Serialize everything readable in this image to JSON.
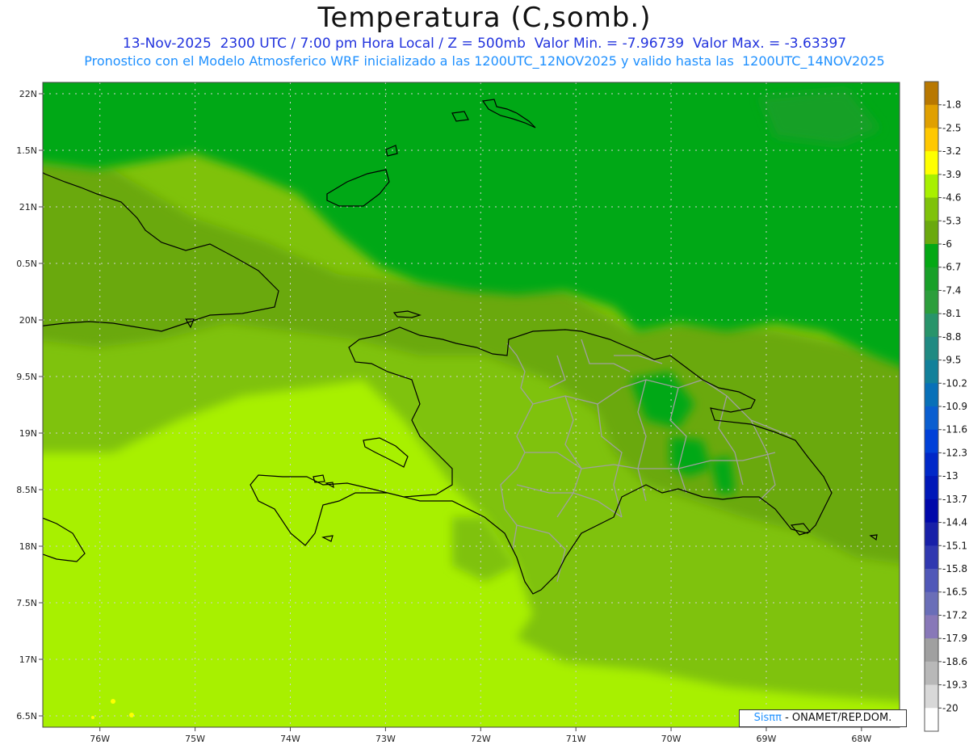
{
  "header": {
    "title": "Temperatura (C,somb.)",
    "subtitle_1": "13-Nov-2025  2300 UTC / 7:00 pm Hora Local / Z = 500mb  Valor Min. = -7.96739  Valor Max. = -3.63397",
    "subtitle_2": "Pronostico con el Modelo Atmosferico WRF inicializado a las 1200UTC_12NOV2025 y valido hasta las  1200UTC_14NOV2025"
  },
  "map": {
    "lon_range": [
      -76.6,
      -67.6
    ],
    "lat_range": [
      16.4,
      22.1
    ],
    "lat_ticks": [
      {
        "value": 22.0,
        "label": "22N"
      },
      {
        "value": 21.5,
        "label": "1.5N"
      },
      {
        "value": 21.0,
        "label": "21N"
      },
      {
        "value": 20.5,
        "label": "0.5N"
      },
      {
        "value": 20.0,
        "label": "20N"
      },
      {
        "value": 19.5,
        "label": "9.5N"
      },
      {
        "value": 19.0,
        "label": "19N"
      },
      {
        "value": 18.5,
        "label": "8.5N"
      },
      {
        "value": 18.0,
        "label": "18N"
      },
      {
        "value": 17.5,
        "label": "7.5N"
      },
      {
        "value": 17.0,
        "label": "17N"
      },
      {
        "value": 16.5,
        "label": "6.5N"
      }
    ],
    "lon_ticks": [
      {
        "value": -76,
        "label": "76W"
      },
      {
        "value": -75,
        "label": "75W"
      },
      {
        "value": -74,
        "label": "74W"
      },
      {
        "value": -73,
        "label": "73W"
      },
      {
        "value": -72,
        "label": "72W"
      },
      {
        "value": -71,
        "label": "71W"
      },
      {
        "value": -70,
        "label": "70W"
      },
      {
        "value": -69,
        "label": "69W"
      },
      {
        "value": -68,
        "label": "68W"
      }
    ],
    "grid": "dotted",
    "fill_colors": {
      "band_minus_6p7": "#04a814",
      "band_minus_6": "#6aa90e",
      "band_minus_5p3": "#7fc20a",
      "band_minus_4p6": "#a8f000",
      "band_minus_3p9": "#ffff00",
      "band_minus_7p4": "#18a028"
    },
    "coastline_color": "#000000",
    "province_border_color": "#a0a0a0"
  },
  "colorbar": {
    "entries": [
      {
        "label": "-1.8",
        "color": "#b87800"
      },
      {
        "label": "-2.5",
        "color": "#e0a000"
      },
      {
        "label": "-3.2",
        "color": "#ffc800"
      },
      {
        "label": "-3.9",
        "color": "#ffff00"
      },
      {
        "label": "-4.6",
        "color": "#a8f000"
      },
      {
        "label": "-5.3",
        "color": "#7fc20a"
      },
      {
        "label": "-6",
        "color": "#6aa90e"
      },
      {
        "label": "-6.7",
        "color": "#04a814"
      },
      {
        "label": "-7.4",
        "color": "#18a028"
      },
      {
        "label": "-8.1",
        "color": "#2c9e3c"
      },
      {
        "label": "-8.8",
        "color": "#28946a"
      },
      {
        "label": "-9.5",
        "color": "#208a82"
      },
      {
        "label": "-10.2",
        "color": "#12809a"
      },
      {
        "label": "-10.9",
        "color": "#0870b8"
      },
      {
        "label": "-11.6",
        "color": "#0a5ed0"
      },
      {
        "label": "-12.3",
        "color": "#0040d8"
      },
      {
        "label": "-13",
        "color": "#0028c8"
      },
      {
        "label": "-13.7",
        "color": "#0018b8"
      },
      {
        "label": "-14.4",
        "color": "#0008aa"
      },
      {
        "label": "-15.1",
        "color": "#1820a8"
      },
      {
        "label": "-15.8",
        "color": "#3038b0"
      },
      {
        "label": "-16.5",
        "color": "#5058b8"
      },
      {
        "label": "-17.2",
        "color": "#6a6eb8"
      },
      {
        "label": "-17.9",
        "color": "#8878b8"
      },
      {
        "label": "-18.6",
        "color": "#a0a0a0"
      },
      {
        "label": "-19.3",
        "color": "#b8b8b8"
      },
      {
        "label": "-20",
        "color": "#d8d8d8"
      },
      {
        "label": "",
        "color": "#ffffff"
      }
    ]
  },
  "credit": {
    "brand": "Sisππ",
    "rest": "- ONAMET/REP.DOM."
  }
}
